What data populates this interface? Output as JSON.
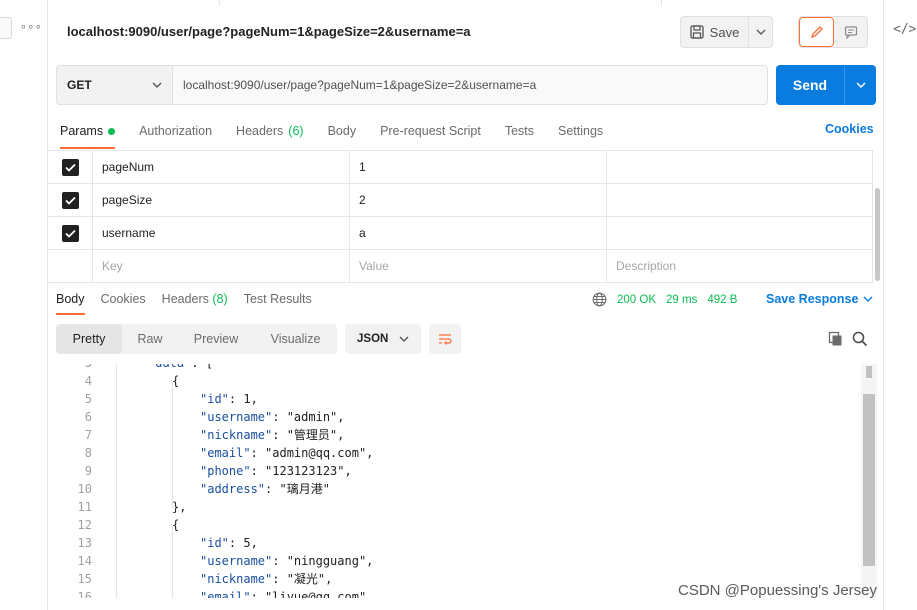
{
  "request": {
    "title": "localhost:9090/user/page?pageNum=1&pageSize=2&username=a",
    "method": "GET",
    "url": "localhost:9090/user/page?pageNum=1&pageSize=2&username=a",
    "save_label": "Save",
    "send_label": "Send"
  },
  "request_tabs": [
    {
      "label": "Params"
    },
    {
      "label": "Authorization"
    },
    {
      "label": "Headers",
      "count": "(6)"
    },
    {
      "label": "Body"
    },
    {
      "label": "Pre-request Script"
    },
    {
      "label": "Tests"
    },
    {
      "label": "Settings"
    }
  ],
  "cookies_link": "Cookies",
  "params": {
    "rows": [
      {
        "key": "pageNum",
        "value": "1",
        "description": ""
      },
      {
        "key": "pageSize",
        "value": "2",
        "description": ""
      },
      {
        "key": "username",
        "value": "a",
        "description": ""
      }
    ],
    "placeholder": {
      "key": "Key",
      "value": "Value",
      "description": "Description"
    }
  },
  "response_tabs": [
    {
      "label": "Body"
    },
    {
      "label": "Cookies"
    },
    {
      "label": "Headers",
      "count": "(8)"
    },
    {
      "label": "Test Results"
    }
  ],
  "response_meta": {
    "status": "200 OK",
    "time": "29 ms",
    "size": "492 B",
    "save_response": "Save Response"
  },
  "view_tabs": [
    "Pretty",
    "Raw",
    "Preview",
    "Visualize"
  ],
  "format": "JSON",
  "code_lines": [
    {
      "n": "3",
      "t": "\"data\": ["
    },
    {
      "n": "4",
      "t": "{"
    },
    {
      "n": "5",
      "t": "\"id\": 1,"
    },
    {
      "n": "6",
      "t": "\"username\": \"admin\","
    },
    {
      "n": "7",
      "t": "\"nickname\": \"管理员\","
    },
    {
      "n": "8",
      "t": "\"email\": \"admin@qq.com\","
    },
    {
      "n": "9",
      "t": "\"phone\": \"123123123\","
    },
    {
      "n": "10",
      "t": "\"address\": \"璃月港\""
    },
    {
      "n": "11",
      "t": "},"
    },
    {
      "n": "12",
      "t": "{"
    },
    {
      "n": "13",
      "t": "\"id\": 5,"
    },
    {
      "n": "14",
      "t": "\"username\": \"ningguang\","
    },
    {
      "n": "15",
      "t": "\"nickname\": \"凝光\","
    },
    {
      "n": "16",
      "t": "\"email\": \"liyue@qq.com\","
    }
  ],
  "watermark": "CSDN @Popuessing's Jersey",
  "colors": {
    "accent": "#ff6c37",
    "send": "#0a7bdf",
    "status_ok": "#0cbb52"
  }
}
